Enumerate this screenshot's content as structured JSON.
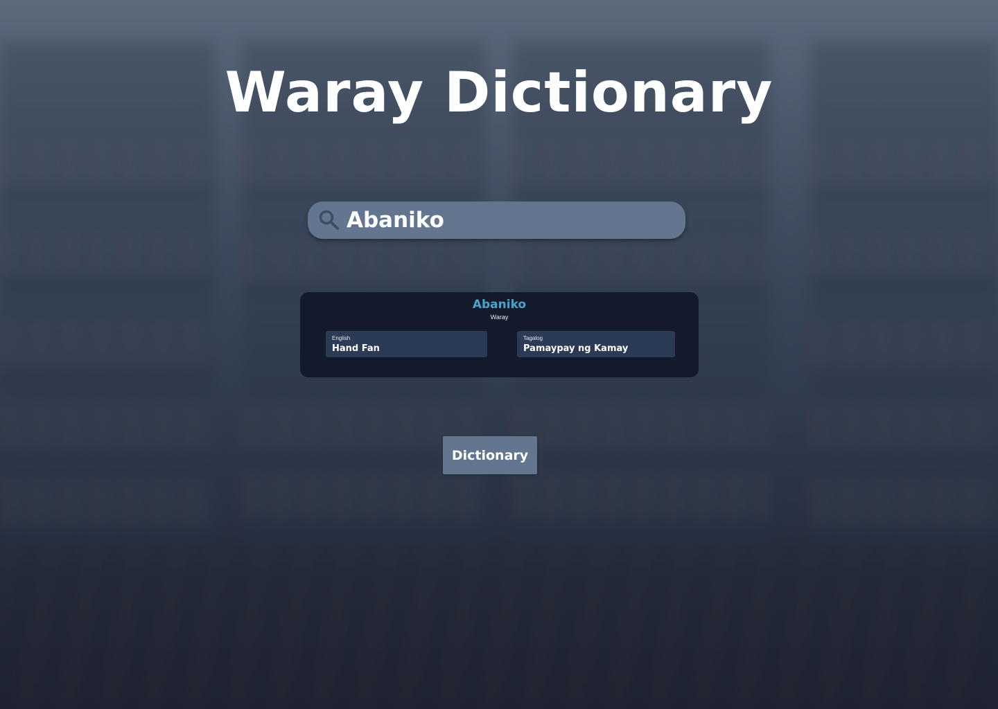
{
  "app": {
    "title": "Waray Dictionary"
  },
  "search": {
    "value": "Abaniko",
    "placeholder": "",
    "icon": "search-icon"
  },
  "result": {
    "word": "Abaniko",
    "language": "Waray",
    "translations": [
      {
        "label": "English",
        "value": "Hand Fan"
      },
      {
        "label": "Tagalog",
        "value": "Pamaypay ng Kamay"
      }
    ]
  },
  "actions": {
    "dictionary_label": "Dictionary"
  },
  "colors": {
    "accent_word": "#48a5c9",
    "search_bar": "#64758f",
    "card_bg": "#121a2c",
    "translation_bg": "#2b3a55"
  }
}
